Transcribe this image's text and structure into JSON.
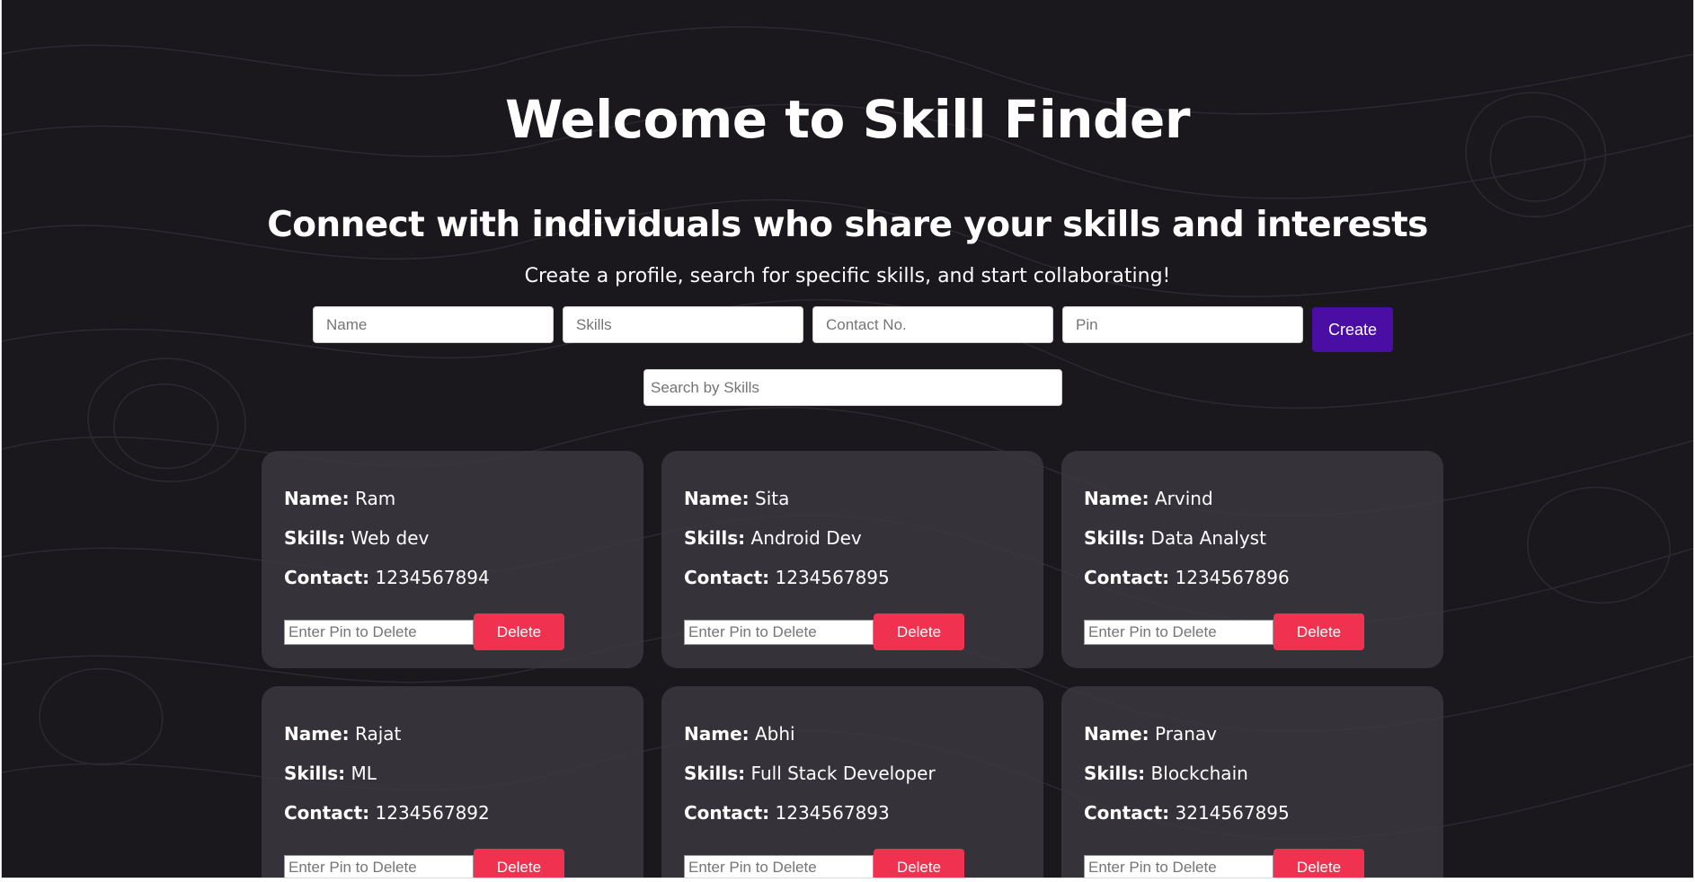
{
  "header": {
    "title": "Welcome to Skill Finder",
    "subtitle": "Connect with individuals who share your skills and interests",
    "tagline": "Create a profile, search for specific skills, and start collaborating!"
  },
  "form": {
    "name_placeholder": "Name",
    "skills_placeholder": "Skills",
    "contact_placeholder": "Contact No.",
    "pin_placeholder": "Pin",
    "create_label": "Create"
  },
  "search": {
    "placeholder": "Search by Skills"
  },
  "card_labels": {
    "name": "Name:",
    "skills": "Skills:",
    "contact": "Contact:",
    "pin_placeholder": "Enter Pin to Delete",
    "delete_label": "Delete"
  },
  "profiles": [
    {
      "name": "Ram",
      "skills": "Web dev",
      "contact": "1234567894"
    },
    {
      "name": "Sita",
      "skills": "Android Dev",
      "contact": "1234567895"
    },
    {
      "name": "Arvind",
      "skills": "Data Analyst",
      "contact": "1234567896"
    },
    {
      "name": "Rajat",
      "skills": "ML",
      "contact": "1234567892"
    },
    {
      "name": "Abhi",
      "skills": "Full Stack Developer",
      "contact": "1234567893"
    },
    {
      "name": "Pranav",
      "skills": "Blockchain",
      "contact": "3214567895"
    }
  ],
  "colors": {
    "background": "#1a171d",
    "card": "#3a373f",
    "create_button": "#4a0ea4",
    "delete_button": "#f0314f",
    "text": "#ffffff"
  }
}
